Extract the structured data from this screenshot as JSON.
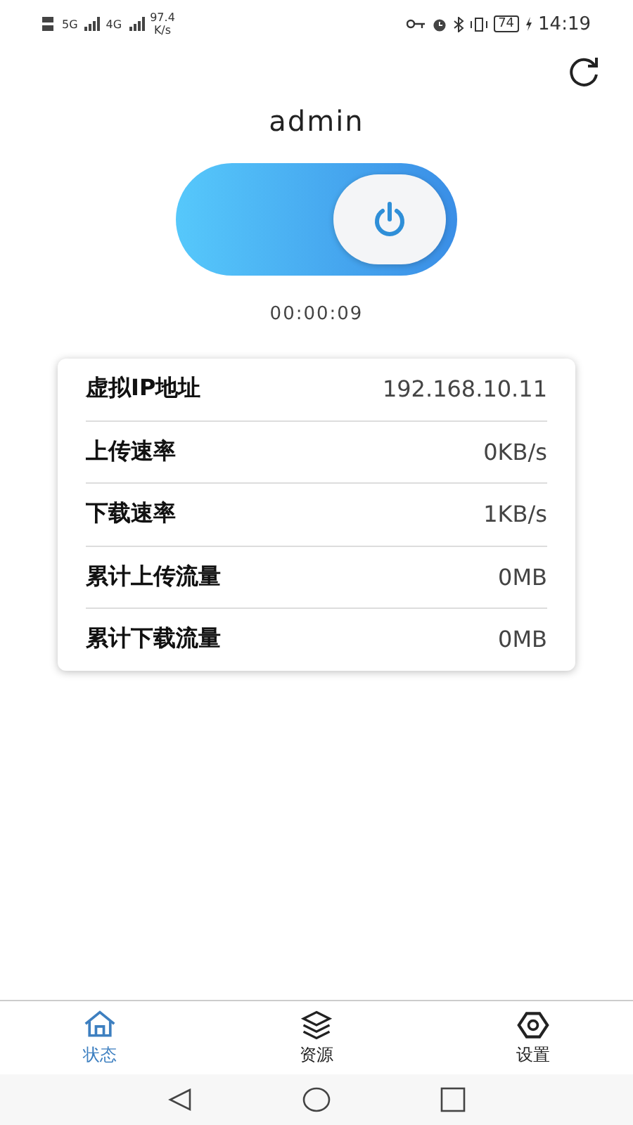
{
  "status_bar": {
    "signal_1": "5G",
    "signal_2": "4G",
    "net_speed": "97.4",
    "net_speed_unit": "K/s",
    "battery": "74",
    "time": "14:19"
  },
  "user": "admin",
  "connection": {
    "on": true,
    "duration": "00:00:09"
  },
  "info": [
    {
      "label": "虚拟IP地址",
      "value": "192.168.10.11"
    },
    {
      "label": "上传速率",
      "value": "0KB/s"
    },
    {
      "label": "下载速率",
      "value": "1KB/s"
    },
    {
      "label": "累计上传流量",
      "value": "0MB"
    },
    {
      "label": "累计下载流量",
      "value": "0MB"
    }
  ],
  "tabs": [
    {
      "label": "状态",
      "kind": "home",
      "selected": true
    },
    {
      "label": "资源",
      "kind": "layers",
      "selected": false
    },
    {
      "label": "设置",
      "kind": "settings",
      "selected": false
    }
  ]
}
